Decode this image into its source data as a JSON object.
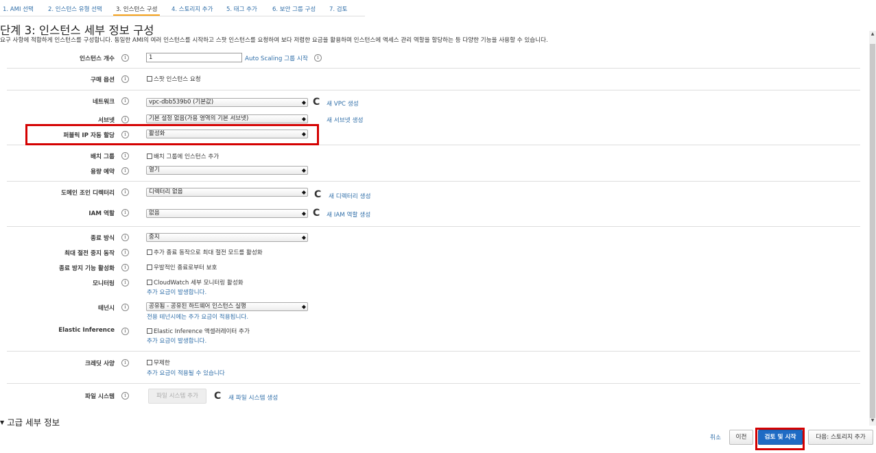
{
  "wizard_steps": [
    "1. AMI 선택",
    "2. 인스턴스 유형 선택",
    "3. 인스턴스 구성",
    "4. 스토리지 추가",
    "5. 태그 추가",
    "6. 보안 그룹 구성",
    "7. 검토"
  ],
  "active_step": 2,
  "page_title": "단계 3: 인스턴스 세부 정보 구성",
  "page_description": "요구 사항에 적합하게 인스턴스를 구성합니다. 동일한 AMI의 여러 인스턴스를 시작하고 스팟 인스턴스를 요청하여 보다 저렴한 요금을 활용하며 인스턴스에 액세스 관리 역할을 할당하는 등 다양한 기능을 사용할 수 있습니다.",
  "info_glyph": "i",
  "refresh_glyph": "C",
  "fields": {
    "instance_count": {
      "label": "인스턴스 개수",
      "value": "1",
      "link": "Auto Scaling 그룹 시작"
    },
    "purchase_option": {
      "label": "구매 옵션",
      "checkbox": "스팟 인스턴스 요청"
    },
    "network": {
      "label": "네트워크",
      "value": "vpc-dbb539b0 (기본값)",
      "link": "새 VPC 생성"
    },
    "subnet": {
      "label": "서브넷",
      "value": "기본 설정 없음(가용 영역의 기본 서브넷)",
      "link": "새 서브넷 생성"
    },
    "public_ip": {
      "label": "퍼블릭 IP 자동 할당",
      "value": "활성화"
    },
    "placement_group": {
      "label": "배치 그룹",
      "checkbox": "배치 그룹에 인스턴스 추가"
    },
    "capacity_reservation": {
      "label": "용량 예약",
      "value": "열기"
    },
    "domain_join": {
      "label": "도메인 조인 디렉터리",
      "value": "디렉터리 없음",
      "link": "새 디렉터리 생성"
    },
    "iam_role": {
      "label": "IAM 역할",
      "value": "없음",
      "link": "새 IAM 역할 생성"
    },
    "shutdown_behavior": {
      "label": "종료 방식",
      "value": "중지"
    },
    "hibernate": {
      "label": "최대 절전 중지 동작",
      "checkbox": "추가 종료 동작으로 최대 절전 모드를 활성화"
    },
    "termination_protection": {
      "label": "종료 방지 기능 활성화",
      "checkbox": "우발적인 종료로부터 보호"
    },
    "monitoring": {
      "label": "모니터링",
      "checkbox": "CloudWatch 세부 모니터링 활성화",
      "note": "추가 요금이 발생합니다."
    },
    "tenancy": {
      "label": "테넌시",
      "value": "공유됨 - 공유된 하드웨어 인스턴스 실행",
      "note": "전용 테넌시에는 추가 요금이 적용됩니다."
    },
    "elastic_inference": {
      "label": "Elastic Inference",
      "checkbox": "Elastic Inference 액셀러레이터 추가",
      "note": "추가 요금이 발생합니다."
    },
    "credit_spec": {
      "label": "크레딧 사양",
      "checkbox": "무제한",
      "note": "추가 요금이 적용될 수 있습니다"
    },
    "file_systems": {
      "label": "파일 시스템",
      "button": "파일 시스템 추가",
      "link": "새 파일 시스템 생성"
    }
  },
  "advanced_details": "고급 세부 정보",
  "footer": {
    "cancel": "취소",
    "previous": "이전",
    "review_launch": "검토 및 시작",
    "next": "다음: 스토리지 추가"
  },
  "colors": {
    "link": "#2f6ea8",
    "primary": "#1f6bc4",
    "active_step": "#f7a21b",
    "highlight": "#d40000"
  }
}
